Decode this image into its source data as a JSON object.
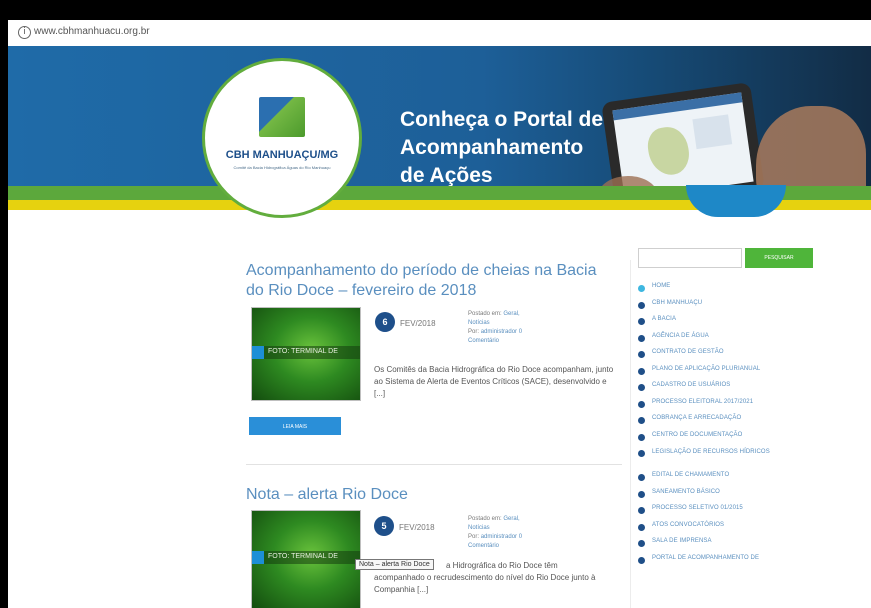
{
  "browser": {
    "url": "www.cbhmanhuacu.org.br"
  },
  "banner": {
    "logo_text": "CBH MANHUAÇU/MG",
    "logo_subtitle": "Comitê da Bacia Hidrográfica Águas do Rio Manhuaçu",
    "headline_1": "Conheça o Portal de",
    "headline_2": "Acompanhamento",
    "headline_3": "de Ações",
    "colors": {
      "blue": "#1f6ba8",
      "green": "#5ca83c",
      "yellow": "#e6d20f"
    }
  },
  "posts": [
    {
      "title": "Acompanhamento do período de cheias na Bacia do Rio Doce – fevereiro de 2018",
      "day": "6",
      "month": "FEV/2018",
      "posted_in_label": "Postado em:",
      "category": "Geral, Notícias",
      "by_label": "Por:",
      "author": "administrador",
      "comments": "0 Comentário",
      "thumb_caption": "FOTO: TERMINAL DE",
      "excerpt": "Os Comitês da Bacia Hidrográfica do Rio Doce acompanham, junto ao Sistema de Alerta de Eventos Críticos (SACE), desenvolvido e [...]",
      "read_more": "LEIA MAIS"
    },
    {
      "title": "Nota – alerta Rio Doce",
      "day": "5",
      "month": "FEV/2018",
      "posted_in_label": "Postado em:",
      "category": "Geral, Notícias",
      "by_label": "Por:",
      "author": "administrador",
      "comments": "0 Comentário",
      "thumb_caption": "FOTO: TERMINAL DE",
      "excerpt_1": "a Hidrográfica do Rio Doce têm",
      "excerpt_2": "acompanhado o recrudescimento do nível do Rio Doce junto à Companhia [...]",
      "tooltip": "Nota – alerta Rio Doce"
    }
  ],
  "sidebar": {
    "search_button": "PESQUISAR",
    "menu": [
      "HOME",
      "CBH MANHUAÇU",
      "A BACIA",
      "AGÊNCIA DE ÁGUA",
      "CONTRATO DE GESTÃO",
      "PLANO DE APLICAÇÃO PLURIANUAL",
      "CADASTRO DE USUÁRIOS",
      "PROCESSO ELEITORAL 2017/2021",
      "COBRANÇA E ARRECADAÇÃO",
      "CENTRO DE DOCUMENTAÇÃO",
      "LEGISLAÇÃO DE RECURSOS HÍDRICOS",
      "EDITAL DE CHAMAMENTO",
      "SANEAMENTO BÁSICO",
      "PROCESSO SELETIVO 01/2015",
      "ATOS CONVOCATÓRIOS",
      "SALA DE IMPRENSA",
      "PORTAL DE ACOMPANHAMENTO DE"
    ]
  }
}
